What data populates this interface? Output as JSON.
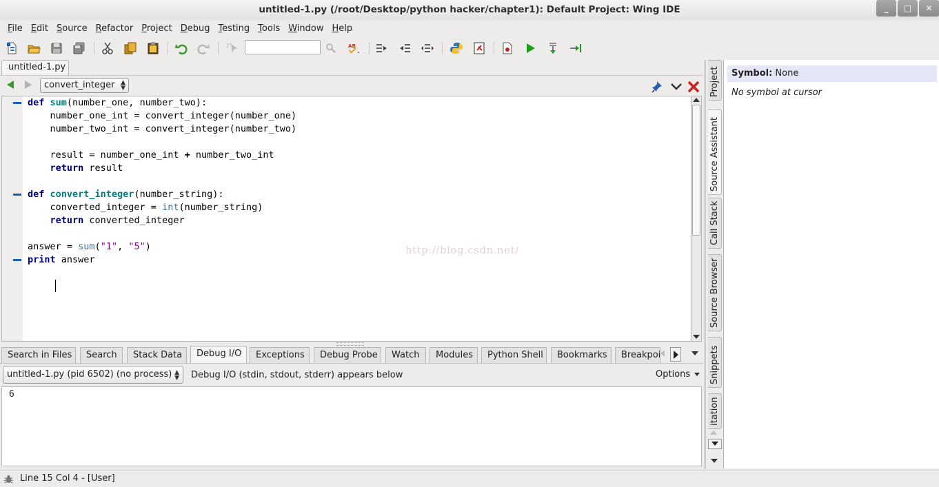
{
  "window": {
    "title": "untitled-1.py (/root/Desktop/python hacker/chapter1): Default Project: Wing IDE",
    "minimize_glyph": "_",
    "maximize_glyph": "□",
    "close_glyph": "✕"
  },
  "menubar": [
    "File",
    "Edit",
    "Source",
    "Refactor",
    "Project",
    "Debug",
    "Testing",
    "Tools",
    "Window",
    "Help"
  ],
  "toolbar": {
    "icons": [
      "new-file-icon",
      "open-folder-icon",
      "save-icon",
      "save-all-icon",
      "cut-icon",
      "copy-icon",
      "paste-icon",
      "undo-icon",
      "redo-icon",
      "pointer-icon",
      "search-icon",
      "spell-check-icon",
      "indent-icon",
      "outdent-icon",
      "indent-toggle-icon",
      "python-icon",
      "close-file-icon",
      "new-debug-icon",
      "run-icon",
      "step-into-icon",
      "step-out-icon"
    ],
    "search_value": "",
    "spell_glyph": "AB"
  },
  "editor": {
    "file_tab": "untitled-1.py",
    "symbol_selector": "convert_integer",
    "caret_position_text": "",
    "code": [
      [
        {
          "t": "kw",
          "v": "def "
        },
        {
          "t": "fn",
          "v": "sum"
        },
        {
          "t": "p",
          "v": "(number_one, number_two):"
        }
      ],
      [
        {
          "t": "p",
          "v": "    number_one_int = convert_integer(number_one)"
        }
      ],
      [
        {
          "t": "p",
          "v": "    number_two_int = convert_integer(number_two)"
        }
      ],
      [
        {
          "t": "p",
          "v": ""
        }
      ],
      [
        {
          "t": "p",
          "v": "    result = number_one_int "
        },
        {
          "t": "op",
          "v": "+"
        },
        {
          "t": "p",
          "v": " number_two_int"
        }
      ],
      [
        {
          "t": "p",
          "v": "    "
        },
        {
          "t": "kw",
          "v": "return"
        },
        {
          "t": "p",
          "v": " result"
        }
      ],
      [
        {
          "t": "p",
          "v": ""
        }
      ],
      [
        {
          "t": "kw",
          "v": "def "
        },
        {
          "t": "fn",
          "v": "convert_integer"
        },
        {
          "t": "p",
          "v": "(number_string):"
        }
      ],
      [
        {
          "t": "p",
          "v": "    converted_integer = "
        },
        {
          "t": "bi",
          "v": "int"
        },
        {
          "t": "p",
          "v": "(number_string)"
        }
      ],
      [
        {
          "t": "p",
          "v": "    "
        },
        {
          "t": "kw",
          "v": "return"
        },
        {
          "t": "p",
          "v": " converted_integer"
        }
      ],
      [
        {
          "t": "p",
          "v": ""
        }
      ],
      [
        {
          "t": "p",
          "v": "answer = "
        },
        {
          "t": "bi",
          "v": "sum"
        },
        {
          "t": "p",
          "v": "("
        },
        {
          "t": "str",
          "v": "\"1\""
        },
        {
          "t": "p",
          "v": ", "
        },
        {
          "t": "str",
          "v": "\"5\""
        },
        {
          "t": "p",
          "v": ")"
        }
      ],
      [
        {
          "t": "kw",
          "v": "print"
        },
        {
          "t": "p",
          "v": " answer"
        }
      ],
      [
        {
          "t": "p",
          "v": ""
        }
      ],
      [
        {
          "t": "p",
          "v": "    "
        }
      ]
    ],
    "fold_lines": [
      0,
      7,
      12
    ],
    "watermark": "http://blog.csdn.net/"
  },
  "bottom_panel": {
    "tabs": [
      "Search in Files",
      "Search",
      "Stack Data",
      "Debug I/O",
      "Exceptions",
      "Debug Probe",
      "Watch",
      "Modules",
      "Python Shell",
      "Bookmarks",
      "Breakpoi"
    ],
    "active_tab": "Debug I/O",
    "process_selector": "untitled-1.py (pid 6502) (no process)",
    "description": "Debug I/O (stdin, stdout, stderr) appears below",
    "options_label": "Options",
    "output": "6"
  },
  "side_tabs": [
    "Project",
    "Source Assistant",
    "Call Stack",
    "Source Browser",
    "Snippets",
    "itation"
  ],
  "side_active": "Source Assistant",
  "assistant": {
    "symbol_label": "Symbol:",
    "symbol_value": "None",
    "no_symbol_text": "No symbol at cursor"
  },
  "statusbar": {
    "text": "Line 15 Col 4 - [User]"
  },
  "colors": {
    "keyword": "#00007f",
    "function_def": "#007f7f",
    "builtin": "#3c6e9c",
    "string": "#7f007f",
    "fold_marker": "#1c5bb4",
    "run_green": "#3a9a2a",
    "close_red": "#cc1f1f"
  }
}
